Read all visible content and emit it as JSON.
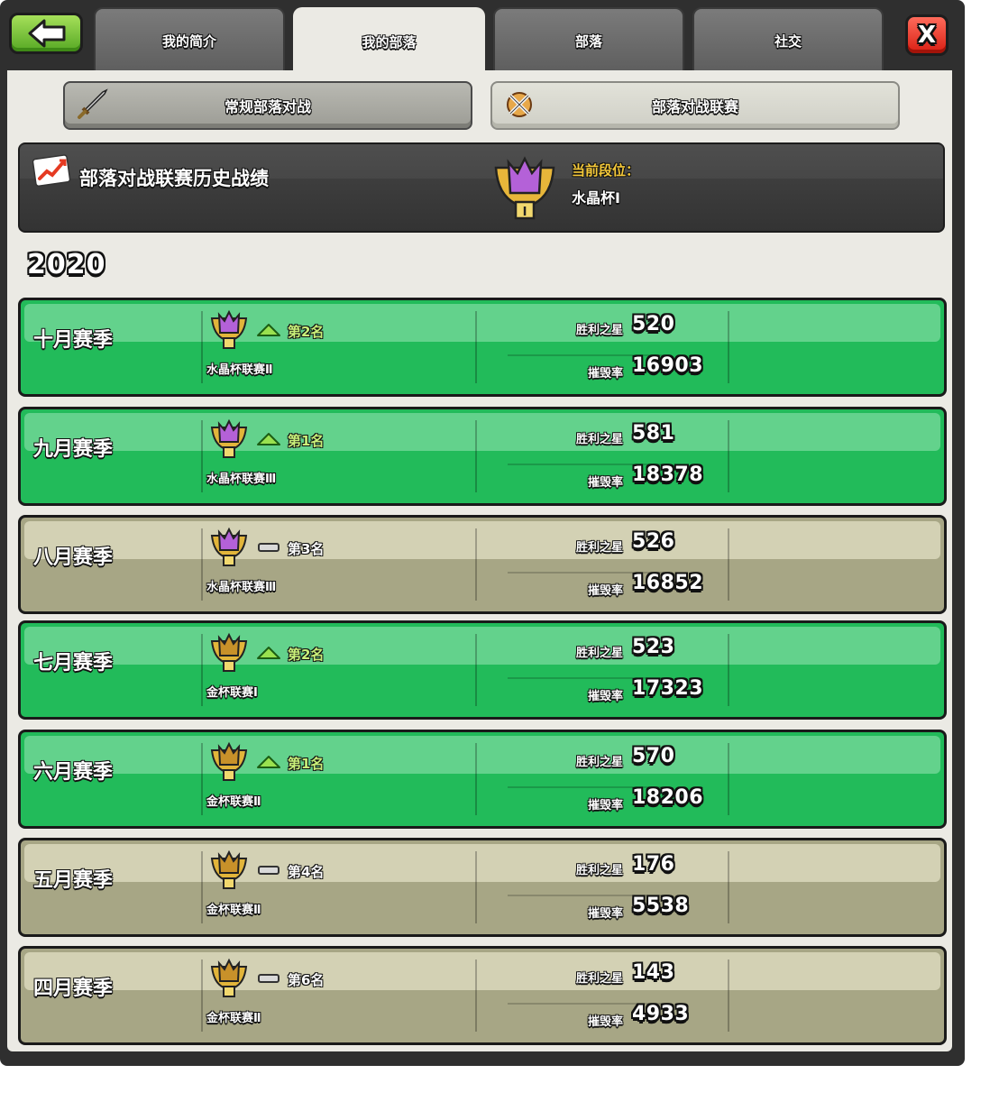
{
  "tabs": [
    {
      "label": "我的简介",
      "active": false
    },
    {
      "label": "我的部落",
      "active": true
    },
    {
      "label": "部落",
      "active": false
    },
    {
      "label": "社交",
      "active": false
    }
  ],
  "close_label": "X",
  "sub_tabs": [
    {
      "label": "常规部落对战",
      "icon": "sword-icon",
      "selected": false
    },
    {
      "label": "部落对战联赛",
      "icon": "crossed-swords-icon",
      "selected": true
    }
  ],
  "header": {
    "title": "部落对战联赛历史战绩",
    "title_icon": "chart-up-icon",
    "rank_label": "当前段位：",
    "rank_value": "水晶杯Ⅰ",
    "rank_badge": "crystal-trophy-icon"
  },
  "year": "2020",
  "seasons": [
    {
      "name": "十月赛季",
      "tier": "crystal",
      "trend": "up",
      "rank": "第2名",
      "league": "水晶杯联赛Ⅱ",
      "stars_label": "胜利之星",
      "stars": "520",
      "destruction_label": "摧毁率",
      "destruction": "16903"
    },
    {
      "name": "九月赛季",
      "tier": "crystal",
      "trend": "up",
      "rank": "第1名",
      "league": "水晶杯联赛Ⅲ",
      "stars_label": "胜利之星",
      "stars": "581",
      "destruction_label": "摧毁率",
      "destruction": "18378"
    },
    {
      "name": "八月赛季",
      "tier": "crystal",
      "trend": "same",
      "rank": "第3名",
      "league": "水晶杯联赛Ⅲ",
      "stars_label": "胜利之星",
      "stars": "526",
      "destruction_label": "摧毁率",
      "destruction": "16852"
    },
    {
      "name": "七月赛季",
      "tier": "gold",
      "trend": "up",
      "rank": "第2名",
      "league": "金杯联赛Ⅰ",
      "stars_label": "胜利之星",
      "stars": "523",
      "destruction_label": "摧毁率",
      "destruction": "17323"
    },
    {
      "name": "六月赛季",
      "tier": "gold",
      "trend": "up",
      "rank": "第1名",
      "league": "金杯联赛Ⅱ",
      "stars_label": "胜利之星",
      "stars": "570",
      "destruction_label": "摧毁率",
      "destruction": "18206"
    },
    {
      "name": "五月赛季",
      "tier": "gold",
      "trend": "same",
      "rank": "第4名",
      "league": "金杯联赛Ⅱ",
      "stars_label": "胜利之星",
      "stars": "176",
      "destruction_label": "摧毁率",
      "destruction": "5538"
    },
    {
      "name": "四月赛季",
      "tier": "gold",
      "trend": "same",
      "rank": "第6名",
      "league": "金杯联赛Ⅱ",
      "stars_label": "胜利之星",
      "stars": "143",
      "destruction_label": "摧毁率",
      "destruction": "4933"
    }
  ],
  "colors": {
    "up_row": "#22bb5a",
    "same_row": "#a7a685",
    "crystal": "#b461d8",
    "gold": "#e2b53a"
  }
}
